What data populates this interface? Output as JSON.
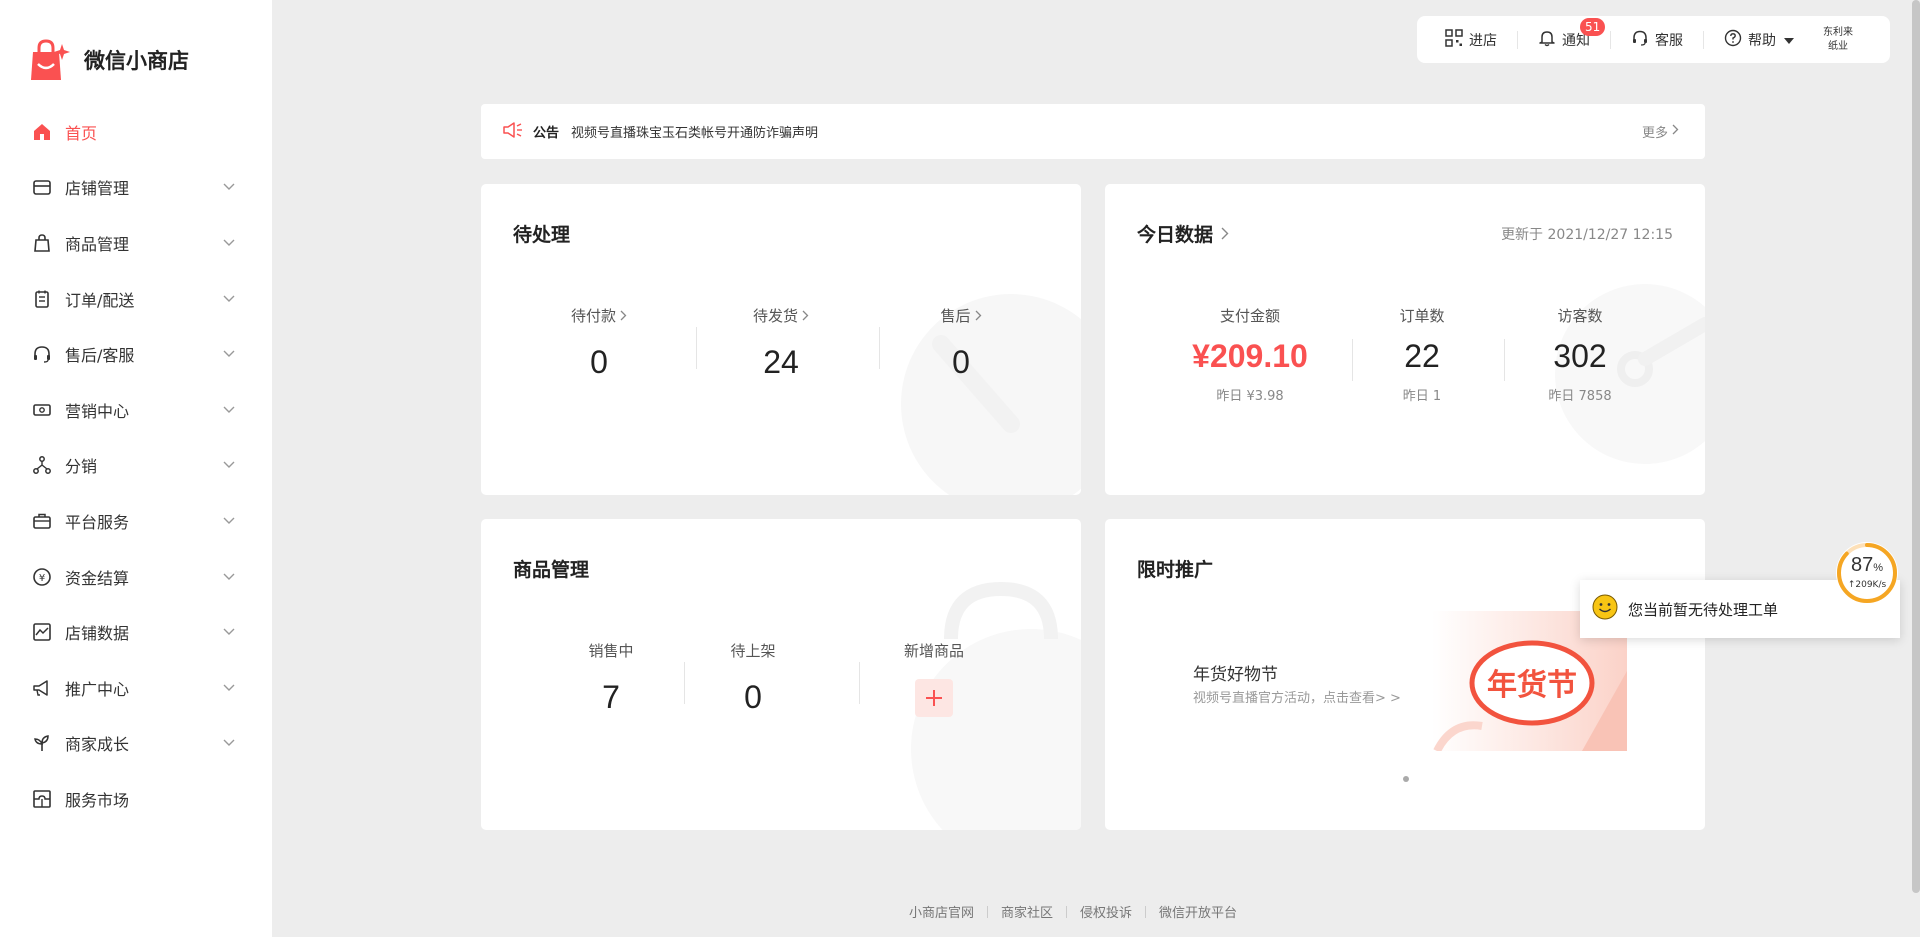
{
  "app": {
    "name": "微信小商店",
    "accent": "#fa5151"
  },
  "sidebar": {
    "items": [
      {
        "label": "首页",
        "icon": "home-icon",
        "active": true,
        "expandable": false
      },
      {
        "label": "店铺管理",
        "icon": "store-icon",
        "expandable": true
      },
      {
        "label": "商品管理",
        "icon": "shopping-bag-icon",
        "expandable": true
      },
      {
        "label": "订单/配送",
        "icon": "clipboard-icon",
        "expandable": true
      },
      {
        "label": "售后/客服",
        "icon": "headset-icon",
        "expandable": true
      },
      {
        "label": "营销中心",
        "icon": "ticket-icon",
        "expandable": true
      },
      {
        "label": "分销",
        "icon": "network-icon",
        "expandable": true
      },
      {
        "label": "平台服务",
        "icon": "briefcase-icon",
        "expandable": true
      },
      {
        "label": "资金结算",
        "icon": "yen-coin-icon",
        "expandable": true
      },
      {
        "label": "店铺数据",
        "icon": "chart-icon",
        "expandable": true
      },
      {
        "label": "推广中心",
        "icon": "megaphone-icon",
        "expandable": true
      },
      {
        "label": "商家成长",
        "icon": "sprout-icon",
        "expandable": true
      },
      {
        "label": "服务市场",
        "icon": "puzzle-icon",
        "expandable": false
      }
    ]
  },
  "topbar": {
    "enter_store": "进店",
    "notify": "通知",
    "notify_count": "51",
    "service": "客服",
    "help": "帮助",
    "user_line1": "东利来",
    "user_line2": "纸业"
  },
  "notice": {
    "tag": "公告",
    "message": "视频号直播珠宝玉石类帐号开通防诈骗声明",
    "more": "更多"
  },
  "pending": {
    "title": "待处理",
    "stats": [
      {
        "label": "待付款",
        "value": "0"
      },
      {
        "label": "待发货",
        "value": "24"
      },
      {
        "label": "售后",
        "value": "0"
      }
    ]
  },
  "today": {
    "title": "今日数据",
    "updated": "更新于 2021/12/27 12:15",
    "stats": [
      {
        "label": "支付金额",
        "value": "¥209.10",
        "yesterday": "昨日 ¥3.98"
      },
      {
        "label": "订单数",
        "value": "22",
        "yesterday": "昨日 1"
      },
      {
        "label": "访客数",
        "value": "302",
        "yesterday": "昨日 7858"
      }
    ]
  },
  "goods": {
    "title": "商品管理",
    "stats": [
      {
        "label": "销售中",
        "value": "7"
      },
      {
        "label": "待上架",
        "value": "0"
      },
      {
        "label": "新增商品"
      }
    ]
  },
  "promo": {
    "title": "限时推广",
    "banner_title": "年货好物节",
    "banner_sub": "视频号直播官方活动，点击查看> >",
    "banner_logo_text": "年货节"
  },
  "footer": {
    "links": [
      "小商店官网",
      "商家社区",
      "侵权投诉",
      "微信开放平台"
    ]
  },
  "toast": {
    "text": "您当前暂无待处理工单"
  },
  "net_widget": {
    "percent": "87",
    "unit": "%",
    "speed": "↑209K/s",
    "fraction": 0.87
  }
}
